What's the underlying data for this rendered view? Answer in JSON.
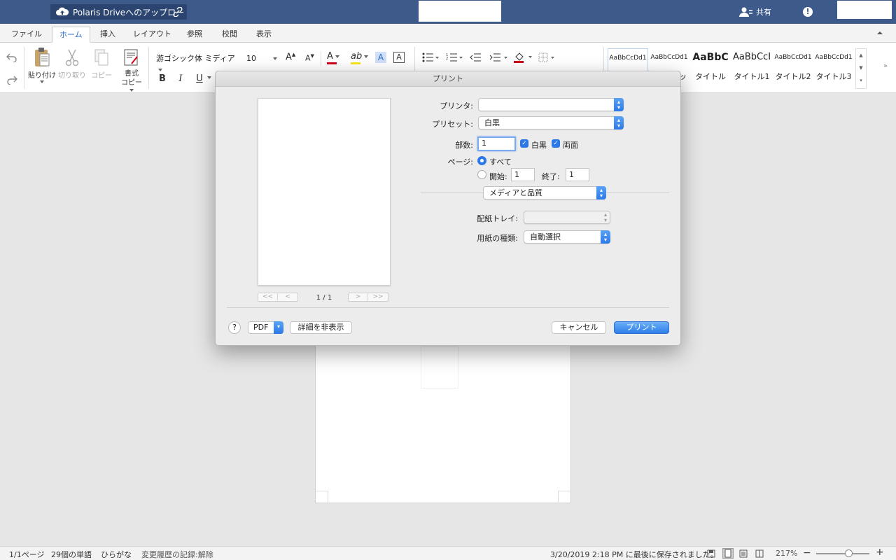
{
  "titlebar": {
    "doc_title": "Polaris Driveへのアップロー",
    "share_label": "共有",
    "alert_label": "!"
  },
  "menu": {
    "tabs": [
      "ファイル",
      "ホーム",
      "挿入",
      "レイアウト",
      "参照",
      "校閲",
      "表示"
    ],
    "active_tab": "ホーム"
  },
  "ribbon": {
    "paste_label": "貼り付け",
    "cut_label": "切り取り",
    "copy_label": "コピー",
    "format_copy_label": "書式\nコピー",
    "font_name": "游ゴシック体 ミディア",
    "font_size": "10",
    "bold": "B",
    "italic": "I",
    "underline": "U",
    "styles": [
      {
        "sample": "AaBbCcDd1",
        "name": ""
      },
      {
        "sample": "AaBbCcDd1",
        "name": "ッ"
      },
      {
        "sample": "AaBbC",
        "name": "タイトル"
      },
      {
        "sample": "AaBbCcI",
        "name": "タイトル1"
      },
      {
        "sample": "AaBbCcDd1",
        "name": "タイトル2"
      },
      {
        "sample": "AaBbCcDd1",
        "name": "タイトル3"
      }
    ],
    "accent_color": "#2b6cc4",
    "font_color": "#d0021b",
    "highlight_color": "#f8e71c"
  },
  "print_dialog": {
    "title": "プリント",
    "printer_label": "プリンタ:",
    "printer_value": "",
    "preset_label": "プリセット:",
    "preset_value": "白黒",
    "copies_label": "部数:",
    "copies_value": "1",
    "bw_label": "白黒",
    "duplex_label": "両面",
    "pages_label": "ページ:",
    "all_label": "すべて",
    "from_label": "開始:",
    "from_value": "1",
    "to_label": "終了:",
    "to_value": "1",
    "section_value": "メディアと品質",
    "tray_label": "配紙トレイ:",
    "tray_value": "",
    "paper_type_label": "用紙の種類:",
    "paper_type_value": "自動選択",
    "page_counter": "1 / 1",
    "help_label": "?",
    "pdf_label": "PDF",
    "hide_details_label": "詳細を非表示",
    "cancel_label": "キャンセル",
    "print_label": "プリント",
    "nav_first": "<<",
    "nav_prev": "<",
    "nav_next": ">",
    "nav_last": ">>"
  },
  "statusbar": {
    "page": "1/1ページ",
    "words": "29個の単語",
    "input_mode": "ひらがな",
    "track_changes": "変更履歴の記録:解除",
    "saved": "3/20/2019 2:18 PM に最後に保存されました。",
    "zoom": "217%",
    "zoom_minus": "−",
    "zoom_plus": "+",
    "zoom_level": 0.61
  }
}
